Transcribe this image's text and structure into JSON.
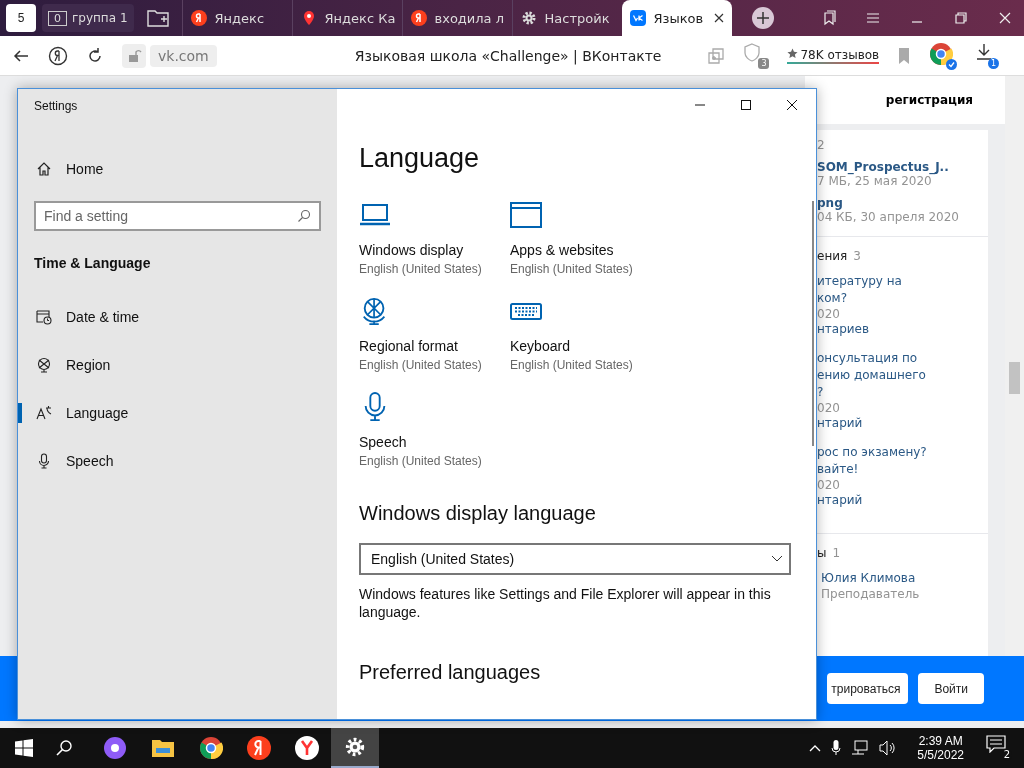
{
  "browser": {
    "home_count": "5",
    "group": {
      "count": "0",
      "label": "группа 1"
    },
    "tabs": [
      {
        "kind": "yandex",
        "label": "Яндекс",
        "selected": false
      },
      {
        "kind": "maps",
        "label": "Яндекс Ка",
        "selected": false
      },
      {
        "kind": "yandex",
        "label": "входила л",
        "selected": false
      },
      {
        "kind": "settings",
        "label": "Настройк",
        "selected": false
      },
      {
        "kind": "vk",
        "label": "Языков",
        "selected": true
      }
    ],
    "url": "vk.com",
    "page_title": "Языковая школа «Challenge» | ВКонтакте",
    "protect_count": "3",
    "reviews": "78K отзывов",
    "download_count": "1"
  },
  "vk": {
    "header_link": "регистрация",
    "files_count": "2",
    "files": [
      {
        "name": "SOM_Prospectus_J..",
        "meta": "7 МБ, 25 мая 2020"
      },
      {
        "name": "png",
        "meta": "04 КБ, 30 апреля 2020"
      }
    ],
    "discussions": {
      "title": "ения",
      "count": "3",
      "topics": [
        {
          "lines": [
            "итературу на",
            "ком?"
          ],
          "date": "020",
          "comments": "нтариев"
        },
        {
          "lines": [
            "онсультация по",
            "ению домашнего",
            "?"
          ],
          "date": "020",
          "comments": "нтарий"
        },
        {
          "lines": [
            "рос по экзамену?",
            "вайте!"
          ],
          "date": "020",
          "comments": "нтарий"
        }
      ]
    },
    "contacts": {
      "title": "ы",
      "count": "1",
      "name": "Юлия Климова",
      "role": "Преподаватель"
    },
    "buttons": [
      "трироваться",
      "Войти"
    ]
  },
  "settings": {
    "title": "Settings",
    "home": "Home",
    "search_placeholder": "Find a setting",
    "section": "Time & Language",
    "nav": [
      {
        "kind": "clock",
        "label": "Date & time",
        "selected": false
      },
      {
        "kind": "region",
        "label": "Region",
        "selected": false
      },
      {
        "kind": "language",
        "label": "Language",
        "selected": true
      },
      {
        "kind": "mic",
        "label": "Speech",
        "selected": false
      }
    ],
    "heading": "Language",
    "tiles": [
      {
        "kind": "display",
        "title": "Windows display",
        "subtitle": "English (United States)"
      },
      {
        "kind": "apps",
        "title": "Apps & websites",
        "subtitle": "English (United States)"
      },
      {
        "kind": "globe",
        "title": "Regional format",
        "subtitle": "English (United States)"
      },
      {
        "kind": "keyboard",
        "title": "Keyboard",
        "subtitle": "English (United States)"
      },
      {
        "kind": "mic",
        "title": "Speech",
        "subtitle": "English (United States)"
      }
    ],
    "display_language": {
      "heading": "Windows display language",
      "value": "English (United States)",
      "note": "Windows features like Settings and File Explorer will appear in this language."
    },
    "preferred_heading": "Preferred languages"
  },
  "taskbar": {
    "apps": [
      {
        "kind": "alice",
        "active": false
      },
      {
        "kind": "explorer",
        "active": false
      },
      {
        "kind": "chrome",
        "active": false
      },
      {
        "kind": "yandex",
        "active": false
      },
      {
        "kind": "ybrowser",
        "active": false
      },
      {
        "kind": "settings",
        "active": true
      }
    ],
    "time": "2:39 AM",
    "date": "5/5/2022",
    "notifications": "2"
  }
}
